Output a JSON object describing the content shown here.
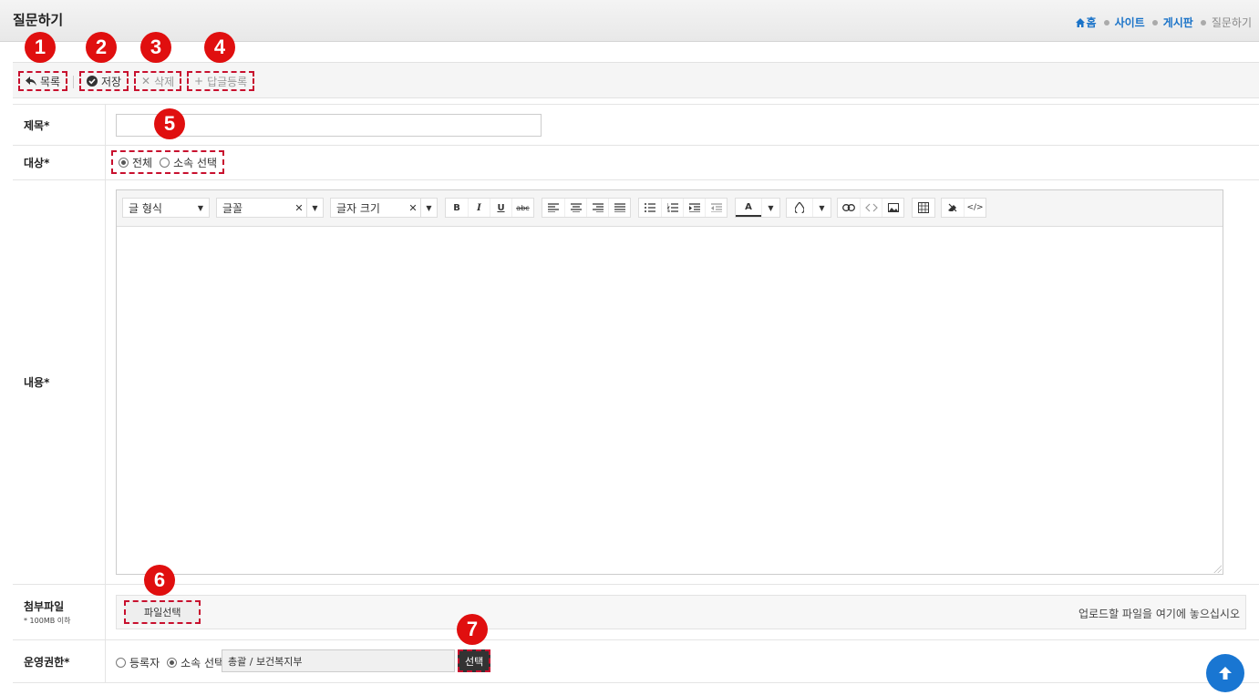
{
  "header": {
    "title": "질문하기",
    "breadcrumb": {
      "home": "홈",
      "site": "사이트",
      "board": "게시판",
      "current": "질문하기"
    }
  },
  "toolbar": {
    "list_label": "목록",
    "save_label": "저장",
    "delete_label": "삭제",
    "reply_label": "답글등록"
  },
  "badges": [
    "1",
    "2",
    "3",
    "4",
    "5",
    "6",
    "7"
  ],
  "form": {
    "title_label": "제목*",
    "title_value": "",
    "target_label": "대상*",
    "target_options": [
      "전체",
      "소속 선택"
    ],
    "target_selected": "전체",
    "content_label": "내용*",
    "editor": {
      "format_select": "글 형식",
      "font_select": "글꼴",
      "size_select": "글자 크기",
      "bold": "B",
      "italic": "I",
      "underline": "U",
      "strike": "abc",
      "text_color": "A"
    },
    "attach_label": "첨부파일",
    "attach_note": "* 100MB 이하",
    "file_button": "파일선택",
    "file_hint": "업로드할 파일을 여기에 놓으십시오",
    "permission_label": "운영권한*",
    "permission_options": [
      "등록자",
      "소속 선택"
    ],
    "permission_selected": "소속 선택",
    "org_value": "총괄 / 보건복지부",
    "org_button": "선택"
  },
  "colors": {
    "accent": "#1976d2",
    "badge": "#e00f0f",
    "dashed": "#c8102e",
    "link": "#1a73c8"
  }
}
